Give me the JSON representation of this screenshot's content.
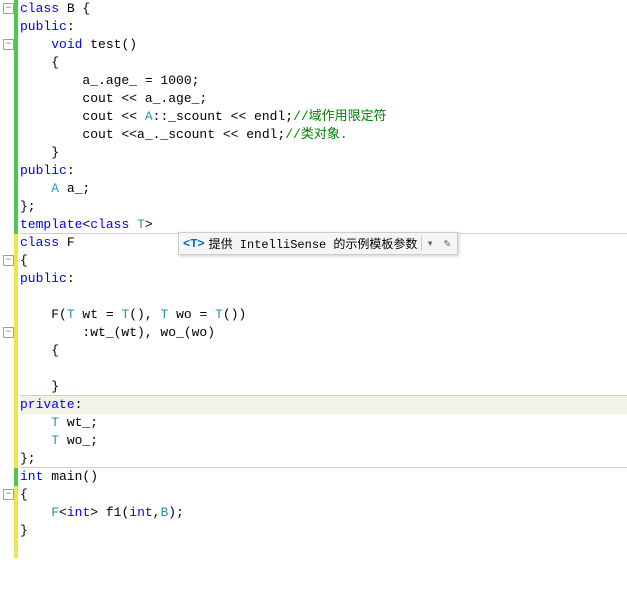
{
  "code": {
    "l1_kw": "class",
    "l1_name": " B {",
    "l2_kw": "public",
    "l2_punct": ":",
    "l3_indent": "    ",
    "l3_kw": "void",
    "l3_rest": " test()",
    "l4": "    {",
    "l5_a": "        a_.age_ = 1000;",
    "l6_a": "        cout << a_.age_;",
    "l7_a": "        cout << ",
    "l7_type": "A",
    "l7_b": "::_scount << endl;",
    "l7_comment": "//域作用限定符",
    "l8_a": "        cout <<a_._scount << endl;",
    "l8_comment": "//类对象.",
    "l9": "    }",
    "l10_kw": "public",
    "l10_p": ":",
    "l11_a": "    ",
    "l11_type": "A",
    "l11_b": " a_;",
    "l12": "};",
    "l13_kw": "template",
    "l13_a": "<",
    "l13_kw2": "class",
    "l13_b": " ",
    "l13_type": "T",
    "l13_c": ">",
    "l14_kw": "class",
    "l14_name": " F",
    "l15": "{",
    "l16_kw": "public",
    "l16_p": ":",
    "l17": "",
    "l18_a": "    F(",
    "l18_type1": "T",
    "l18_b": " wt = ",
    "l18_type2": "T",
    "l18_c": "(), ",
    "l18_type3": "T",
    "l18_d": " wo = ",
    "l18_type4": "T",
    "l18_e": "())",
    "l19": "        :wt_(wt), wo_(wo)",
    "l20": "    {",
    "l21": "",
    "l22": "    }",
    "l23_kw": "private",
    "l23_p": ":",
    "l24_a": "    ",
    "l24_type": "T",
    "l24_b": " wt_;",
    "l25_a": "    ",
    "l25_type": "T",
    "l25_b": " wo_;",
    "l26": "};",
    "l27_kw": "int",
    "l27_rest": " main()",
    "l28": "{",
    "l29_a": "    ",
    "l29_type": "F",
    "l29_b": "<",
    "l29_kw": "int",
    "l29_c": "> f1(",
    "l29_kw2": "int",
    "l29_d": ",",
    "l29_type2": "B",
    "l29_e": ");",
    "l30": "}"
  },
  "intellisense": {
    "label": "<T>",
    "text": "提供 IntelliSense 的示例模板参数",
    "dropdown_icon": "▾",
    "edit_icon": "✎"
  }
}
